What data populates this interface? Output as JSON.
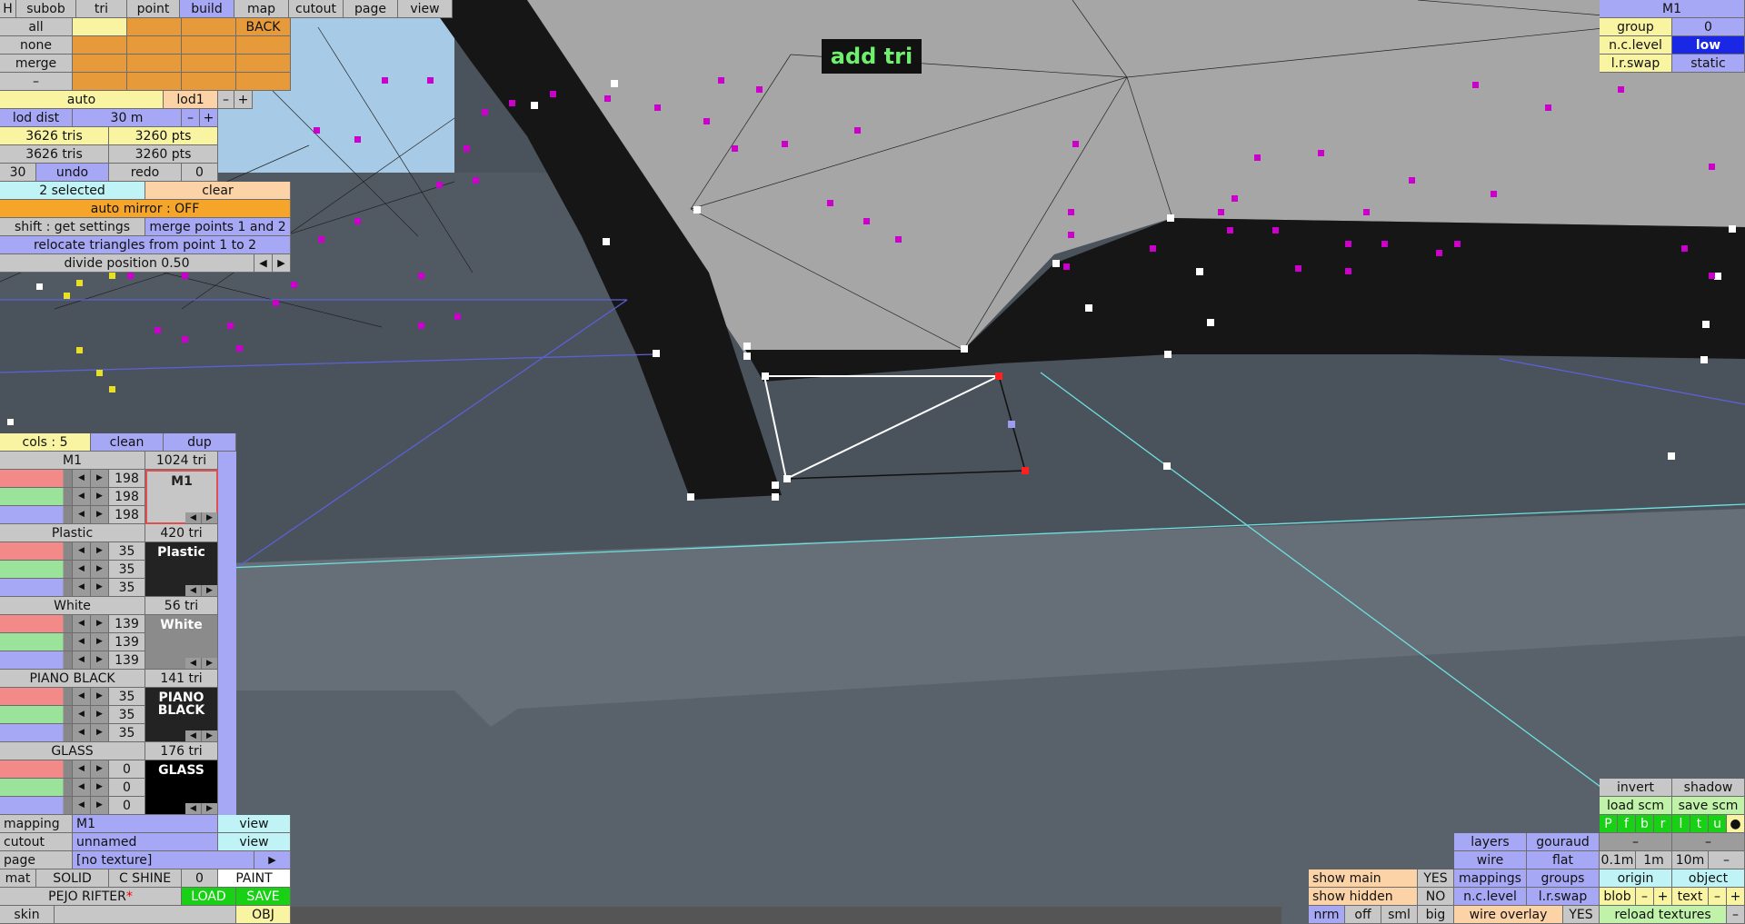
{
  "overlay": {
    "mode_label": "add tri"
  },
  "top_menu": {
    "h": "H",
    "items": [
      "subob",
      "tri",
      "point",
      "build",
      "map",
      "cutout",
      "page",
      "view"
    ],
    "active": "build"
  },
  "select": {
    "all": "all",
    "none": "none",
    "merge": "merge",
    "dash": "–",
    "back": "BACK"
  },
  "lod": {
    "auto": "auto",
    "level": "lod1",
    "minus": "–",
    "plus": "+",
    "dist_label": "lod dist",
    "dist_value": "30 m",
    "dist_minus": "–",
    "dist_plus": "+"
  },
  "counts": {
    "tris_a": "3626 tris",
    "pts_a": "3260 pts",
    "tris_b": "3626 tris",
    "pts_b": "3260 pts"
  },
  "history": {
    "left": "30",
    "undo": "undo",
    "redo": "redo",
    "right": "0"
  },
  "selection": {
    "selected": "2 selected",
    "clear": "clear",
    "auto_mirror": "auto mirror : OFF",
    "shift_get": "shift : get settings",
    "merge_points": "merge points 1 and 2",
    "relocate": "relocate triangles from point 1 to 2",
    "divide": "divide position 0.50"
  },
  "colors_panel": {
    "cols": "cols : 5",
    "clean": "clean",
    "dup": "dup",
    "materials": [
      {
        "name": "M1",
        "tri": "1024 tri",
        "r": "198",
        "g": "198",
        "b": "198",
        "swatch": "M1",
        "color": "#c6c6c6",
        "text_color": "#222222"
      },
      {
        "name": "Plastic",
        "tri": "420 tri",
        "r": "35",
        "g": "35",
        "b": "35",
        "swatch": "Plastic",
        "color": "#232323",
        "text_color": "#ffffff"
      },
      {
        "name": "White",
        "tri": "56 tri",
        "r": "139",
        "g": "139",
        "b": "139",
        "swatch": "White",
        "color": "#8b8b8b",
        "text_color": "#ffffff"
      },
      {
        "name": "PIANO BLACK",
        "tri": "141 tri",
        "r": "35",
        "g": "35",
        "b": "35",
        "swatch": "PIANO BLACK",
        "color": "#232323",
        "text_color": "#ffffff"
      },
      {
        "name": "GLASS",
        "tri": "176 tri",
        "r": "0",
        "g": "0",
        "b": "0",
        "swatch": "GLASS",
        "color": "#000000",
        "text_color": "#ffffff"
      }
    ]
  },
  "bottom_left": {
    "mapping_label": "mapping",
    "mapping_value": "M1",
    "mapping_view": "view",
    "cutout_label": "cutout",
    "cutout_value": "unnamed",
    "cutout_view": "view",
    "page_label": "page",
    "page_value": "[no texture]",
    "page_arrow": "▶",
    "mat": "mat",
    "solid": "SOLID",
    "cshine": "C SHINE",
    "zero": "0",
    "paint": "PAINT",
    "file": "PEJO RIFTER",
    "file_mark": "*",
    "load": "LOAD",
    "save": "SAVE",
    "skin": "skin",
    "obj": "OBJ"
  },
  "top_right": {
    "title": "M1",
    "group_label": "group",
    "group_value": "0",
    "nc_label": "n.c.level",
    "nc_value": "low",
    "lr_label": "l.r.swap",
    "lr_value": "static"
  },
  "bottom_right": {
    "invert": "invert",
    "shadow": "shadow",
    "load_scm": "load scm",
    "save_scm": "save scm",
    "flags": [
      "P",
      "f",
      "b",
      "r",
      "l",
      "t",
      "u",
      "●"
    ],
    "dash1": "–",
    "dash2": "–",
    "layers": "layers",
    "gouraud": "gouraud",
    "wire": "wire",
    "flat": "flat",
    "mappings": "mappings",
    "groups": "groups",
    "nclevel": "n.c.level",
    "lrswap": "l.r.swap",
    "wire_overlay": "wire overlay",
    "wire_overlay_val": "YES",
    "show_main": "show main",
    "show_main_val": "YES",
    "show_hidden": "show hidden",
    "show_hidden_val": "NO",
    "nrm": "nrm",
    "off": "off",
    "sml": "sml",
    "big": "big",
    "d01": "0.1m",
    "d1": "1m",
    "d10": "10m",
    "dminus": "–",
    "origin": "origin",
    "object": "object",
    "blob": "blob",
    "bminus": "–",
    "bplus": "+",
    "text": "text",
    "tminus": "–",
    "tplus": "+",
    "reload": "reload textures",
    "rminus": "–"
  }
}
